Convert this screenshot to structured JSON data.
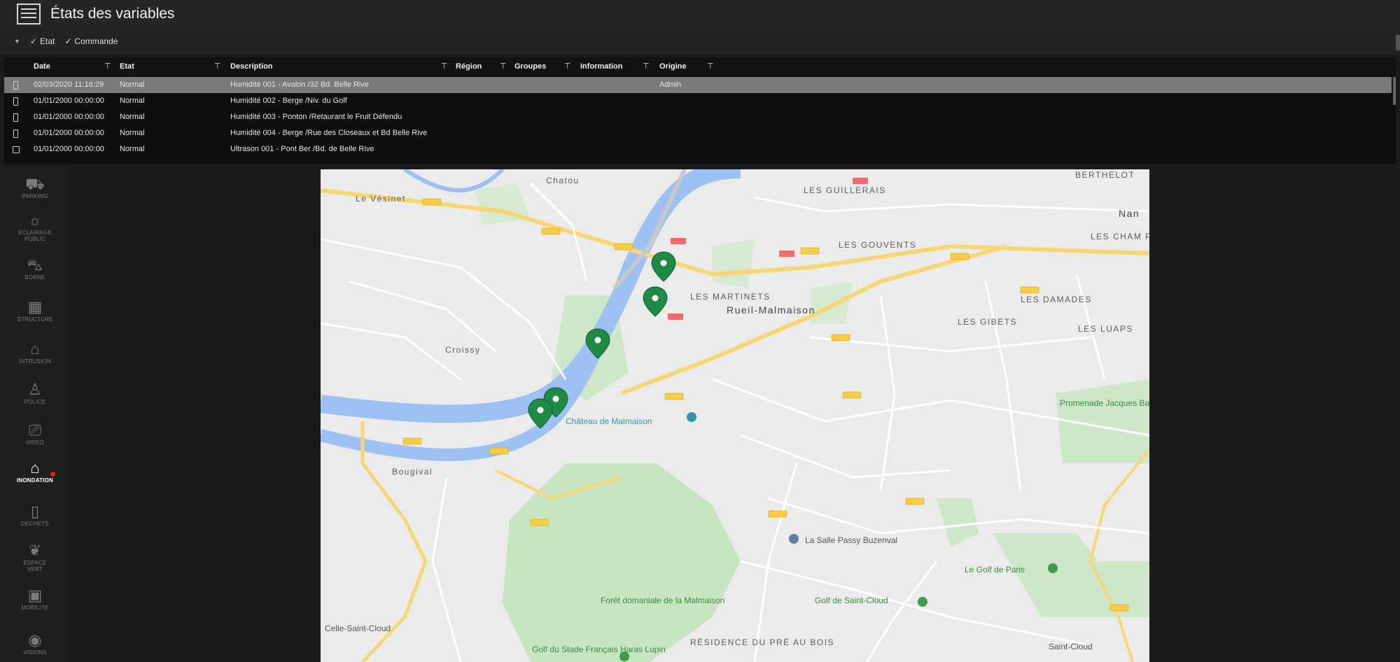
{
  "window": {
    "title": "États des variables"
  },
  "toolbar": {
    "filters": [
      {
        "label": "Etat",
        "checked": true
      },
      {
        "label": "Commande",
        "checked": true
      }
    ]
  },
  "grid": {
    "columns": [
      "Date",
      "Etat",
      "Description",
      "Région",
      "Groupes",
      "Information",
      "Origine"
    ],
    "rows": [
      {
        "date": "02/03/2020 11:16:29",
        "etat": "Normal",
        "description": "Humidité 001 - Avalon /32 Bd. Belle Rive",
        "origine": "Admin",
        "selected": true
      },
      {
        "date": "01/01/2000 00:00:00",
        "etat": "Normal",
        "description": "Humidité 002 - Berge /Niv. du Golf",
        "origine": "",
        "selected": false
      },
      {
        "date": "01/01/2000 00:00:00",
        "etat": "Normal",
        "description": "Humidité 003 - Ponton /Retaurant le Fruit Défendu",
        "origine": "",
        "selected": false
      },
      {
        "date": "01/01/2000 00:00:00",
        "etat": "Normal",
        "description": "Humidité 004 - Berge /Rue des Closeaux et Bd Belle Rive",
        "origine": "",
        "selected": false
      },
      {
        "date": "01/01/2000 00:00:00",
        "etat": "Normal",
        "description": "Ultrason 001 - Pont Ber /Bd. de Belle Rive",
        "origine": "",
        "selected": false
      }
    ]
  },
  "sidebar": {
    "items": [
      {
        "label": "PARKING",
        "icon": "parking-icon"
      },
      {
        "label": "ECLAIRAGE PUBLIC",
        "icon": "lamp-icon"
      },
      {
        "label": "BORNE",
        "icon": "car-icon"
      },
      {
        "label": "STRUCTURE",
        "icon": "building-icon"
      },
      {
        "label": "INTRUSION",
        "icon": "house-icon"
      },
      {
        "label": "POLICE",
        "icon": "police-icon"
      },
      {
        "label": "VIDEO",
        "icon": "camera-icon"
      },
      {
        "label": "INONDATION",
        "icon": "flood-icon",
        "active": true,
        "alert": true
      },
      {
        "label": "DECHETS",
        "icon": "trash-icon"
      },
      {
        "label": "ESPACE VERT",
        "icon": "leaf-icon"
      },
      {
        "label": "MOBILITE",
        "icon": "mobility-icon"
      },
      {
        "label": "VISIONS",
        "icon": "eye-icon"
      }
    ]
  },
  "map": {
    "labels": {
      "chatou": "Chatou",
      "le_vesinet": "Le Vésinet",
      "croissy": "Croissy",
      "bougival": "Bougival",
      "les_guillerais": "LES GUILLERAIS",
      "les_gouvents": "LES GOUVENTS",
      "les_martinets": "LES MARTINETS",
      "rueil": "Rueil-Malmaison",
      "les_damades": "LES DAMADES",
      "les_gibets": "LES GIBETS",
      "les_luaps": "LES LUAPS",
      "berthelot": "BERTHELOT",
      "nan": "Nan",
      "les_champs_pierreux": "LES CHAM PIERRE",
      "chateau": "Château de Malmaison",
      "promenade": "Promenade Jacques Baumel",
      "salle_passy": "La Salle Passy Buzenval",
      "golf_paris": "Le Golf de Paris",
      "foret": "Forêt domaniale de la Malmaison",
      "golf_st_cloud": "Golf de Saint-Cloud",
      "residence": "RÉSIDENCE DU PRÉ AU BOIS",
      "golf_stade": "Golf du Stade Français Haras Lupin",
      "celle": "Celle-Saint-Cloud",
      "saint_cloud": "Saint-Cloud"
    }
  }
}
